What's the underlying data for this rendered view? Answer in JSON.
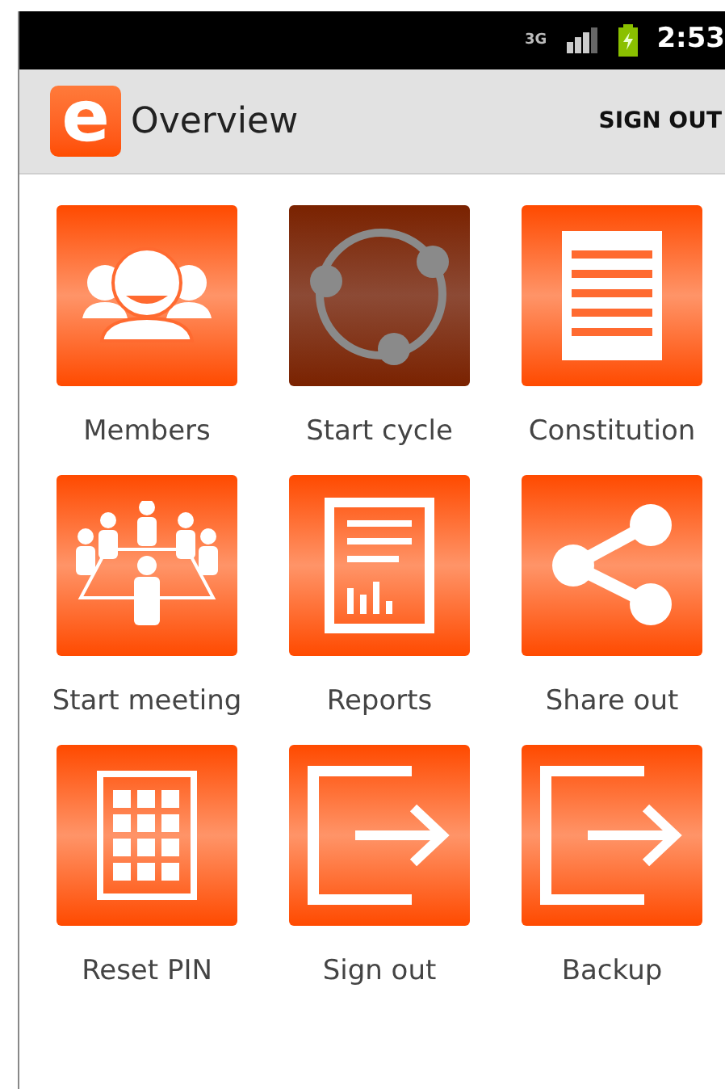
{
  "status_bar": {
    "network": "3G",
    "time": "2:53"
  },
  "action_bar": {
    "logo": "e",
    "title": "Overview",
    "action": "SIGN OUT"
  },
  "tiles": [
    {
      "label": "Members",
      "kind": "members",
      "selected": false
    },
    {
      "label": "Start cycle",
      "kind": "cycle",
      "selected": true
    },
    {
      "label": "Constitution",
      "kind": "document",
      "selected": false
    },
    {
      "label": "Start meeting",
      "kind": "meeting",
      "selected": false
    },
    {
      "label": "Reports",
      "kind": "report",
      "selected": false
    },
    {
      "label": "Share out",
      "kind": "share",
      "selected": false
    },
    {
      "label": "Reset PIN",
      "kind": "keypad",
      "selected": false
    },
    {
      "label": "Sign out",
      "kind": "exit",
      "selected": false
    },
    {
      "label": "Backup",
      "kind": "exit",
      "selected": false
    }
  ]
}
